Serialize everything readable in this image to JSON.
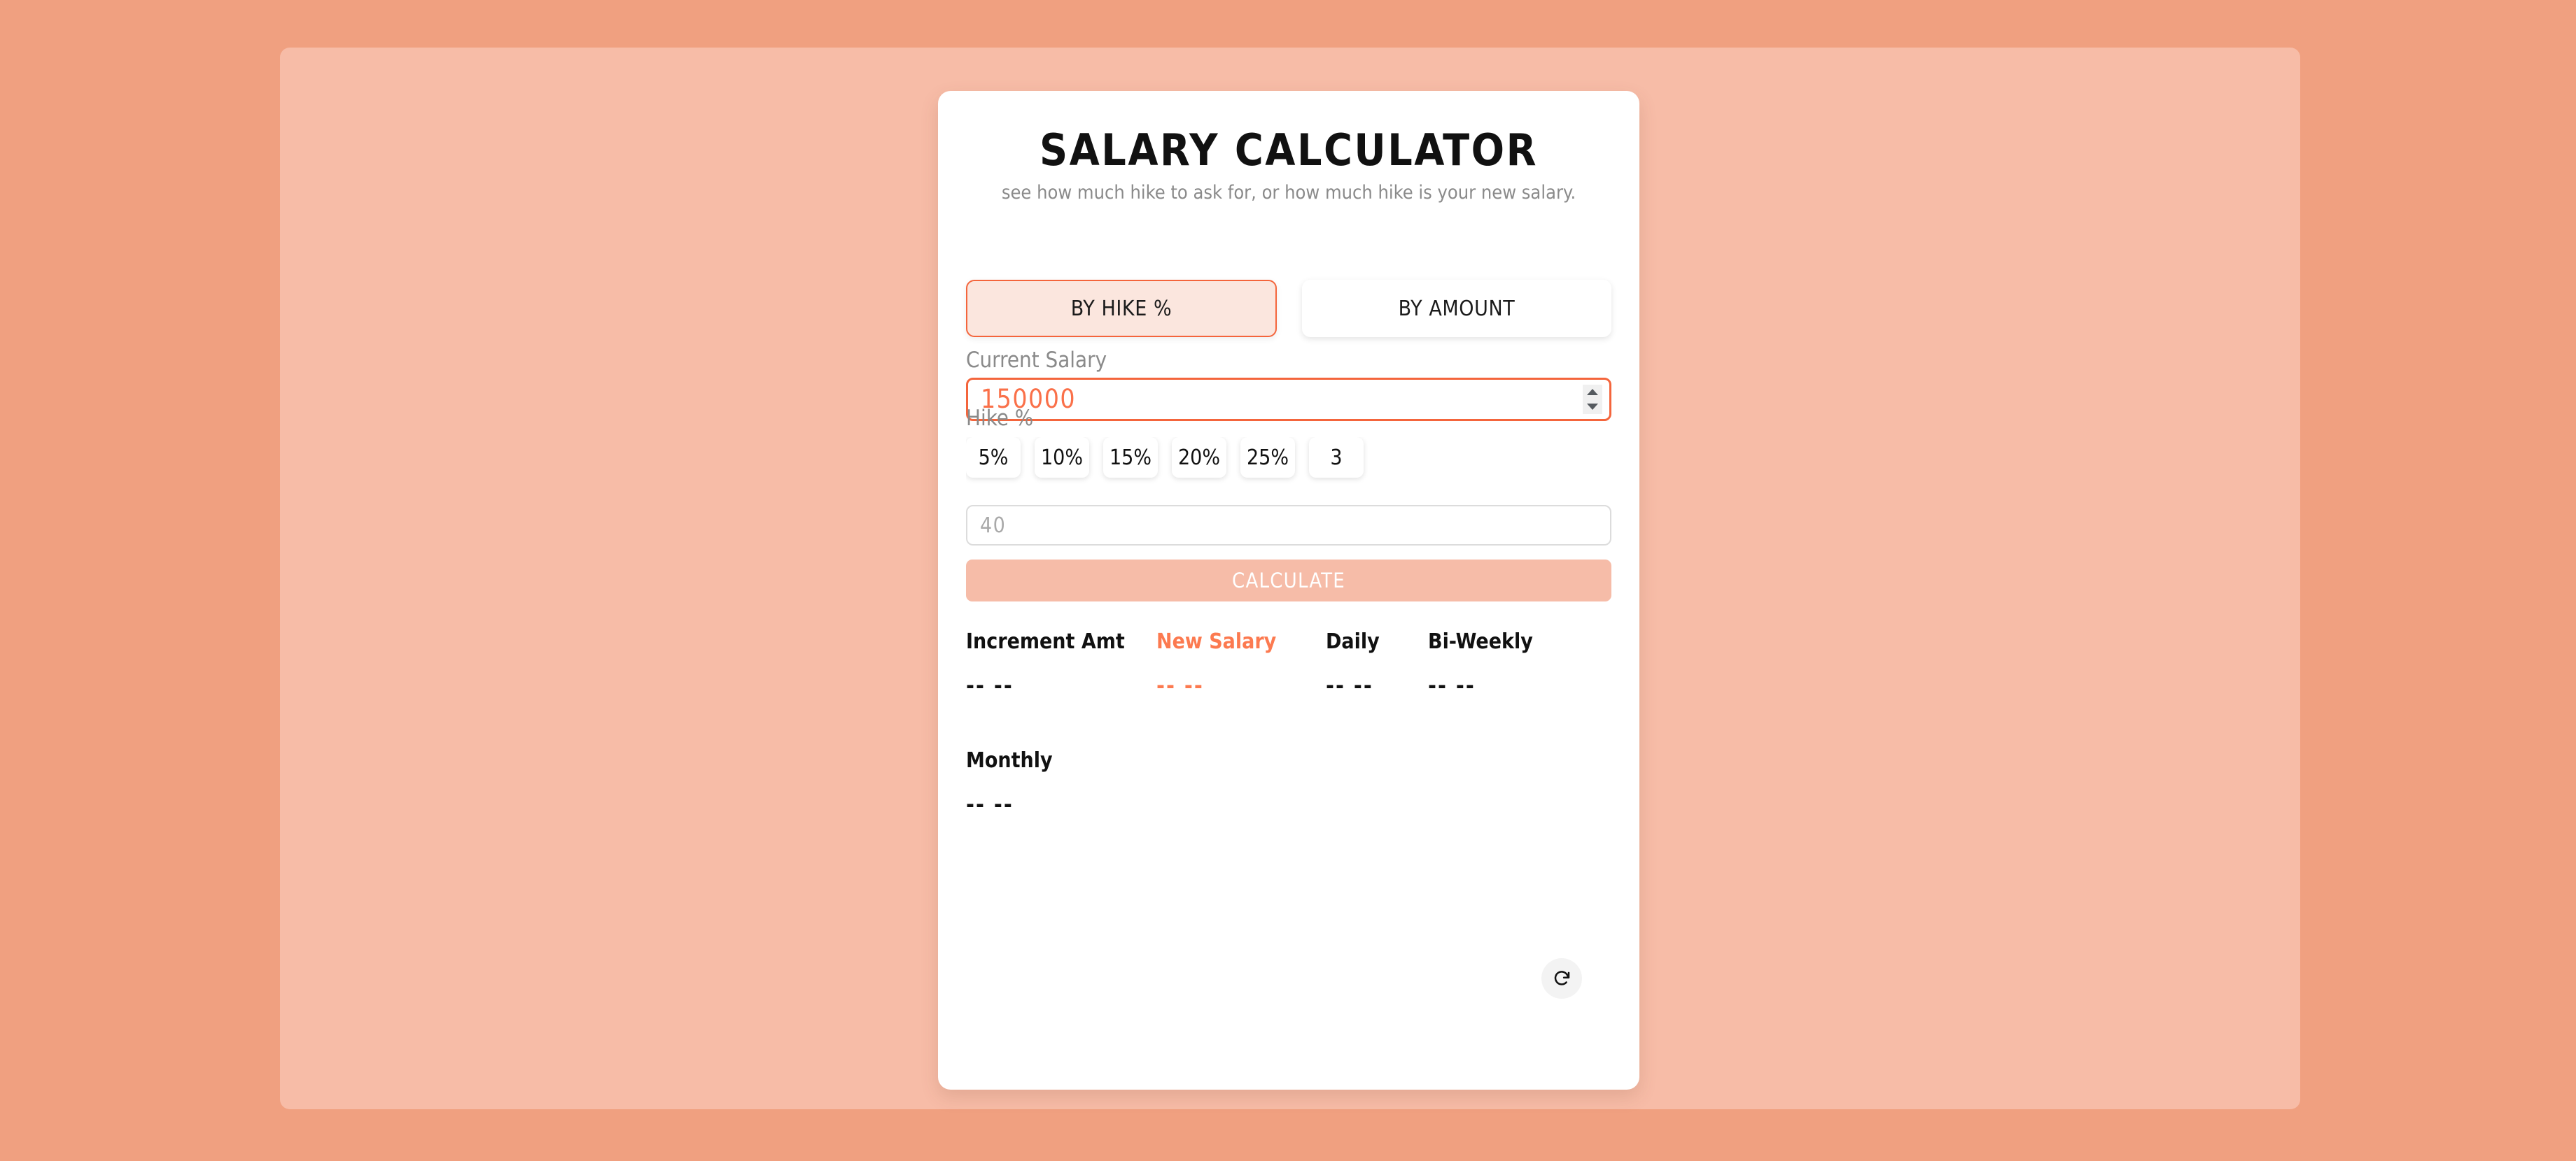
{
  "header": {
    "title": "SALARY CALCULATOR",
    "subtitle": "see how much hike to ask for, or how much hike is your new salary."
  },
  "colors": {
    "accent": "#fc7a50",
    "accent_border": "#f4653c",
    "accent_soft_bg": "#fbe6de",
    "button_disabled_bg": "#f6bca8",
    "page_background": "#f0a080",
    "panel_background": "#f7bca7",
    "card_background": "#ffffff",
    "muted_text": "#8a8a8a"
  },
  "tabs": [
    {
      "label": "BY HIKE %",
      "active": true
    },
    {
      "label": "BY AMOUNT",
      "active": false
    }
  ],
  "fields": {
    "current_salary": {
      "label": "Current Salary",
      "value": "150000",
      "placeholder": "",
      "spinner": {
        "up_icon": "caret-up-icon",
        "down_icon": "caret-down-icon"
      }
    },
    "hike_percent": {
      "label": "Hike %",
      "chips": [
        "5%",
        "10%",
        "15%",
        "20%",
        "25%",
        "3"
      ],
      "custom_value": "",
      "custom_placeholder": "40"
    }
  },
  "actions": {
    "calculate_label": "CALCULATE",
    "reset_icon": "refresh-icon"
  },
  "results": [
    {
      "label": "Increment Amt",
      "value": "--  --",
      "accent": false
    },
    {
      "label": "New Salary",
      "value": "--  --",
      "accent": true
    },
    {
      "label": "Daily",
      "value": "--  --",
      "accent": false
    },
    {
      "label": "Bi-Weekly",
      "value": "--  --",
      "accent": false
    },
    {
      "label": "Monthly",
      "value": "--  --",
      "accent": false
    }
  ]
}
